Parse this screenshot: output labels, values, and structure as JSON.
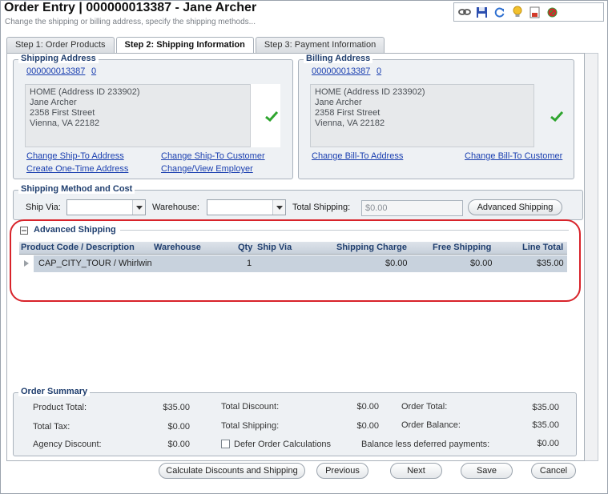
{
  "header": {
    "title": "Order Entry | 000000013387 - Jane Archer",
    "subtitle": "Change the shipping or billing address, specify the shipping methods..."
  },
  "toolbar": {
    "icons": [
      "link-icon",
      "save-icon",
      "refresh-icon",
      "lightbulb-icon",
      "report-icon",
      "cancel-order-icon"
    ]
  },
  "tabs": [
    {
      "label": "Step 1: Order Products",
      "active": false
    },
    {
      "label": "Step 2: Shipping Information",
      "active": true
    },
    {
      "label": "Step 3: Payment Information",
      "active": false
    }
  ],
  "shipping_address": {
    "title": "Shipping Address",
    "id_link": "000000013387",
    "id_suffix_link": "0",
    "lines": [
      "HOME (Address ID 233902)",
      "Jane Archer",
      "2358 First Street",
      "Vienna, VA 22182"
    ],
    "links": {
      "change_ship_to_address": "Change Ship-To Address",
      "create_one_time_address": "Create One-Time Address",
      "change_ship_to_customer": "Change Ship-To Customer",
      "change_view_employer": "Change/View Employer"
    }
  },
  "billing_address": {
    "title": "Billing Address",
    "id_link": "000000013387",
    "id_suffix_link": "0",
    "lines": [
      "HOME (Address ID 233902)",
      "Jane Archer",
      "2358 First Street",
      "Vienna, VA 22182"
    ],
    "links": {
      "change_bill_to_address": "Change Bill-To Address",
      "change_bill_to_customer": "Change Bill-To Customer"
    }
  },
  "shipping_method": {
    "title": "Shipping Method and Cost",
    "ship_via_label": "Ship Via:",
    "ship_via_value": "",
    "warehouse_label": "Warehouse:",
    "warehouse_value": "",
    "total_shipping_label": "Total Shipping:",
    "total_shipping_value": "$0.00",
    "advanced_button": "Advanced Shipping"
  },
  "advanced_shipping": {
    "title": "Advanced Shipping",
    "columns": [
      "Product Code / Description",
      "Warehouse",
      "Qty",
      "Ship Via",
      "Shipping Charge",
      "Free Shipping",
      "Line Total"
    ],
    "rows": [
      {
        "product": "CAP_CITY_TOUR / Whirlwin",
        "warehouse": "",
        "qty": "1",
        "ship_via": "",
        "shipping_charge": "$0.00",
        "free_shipping": "$0.00",
        "line_total": "$35.00"
      }
    ]
  },
  "order_summary": {
    "title": "Order Summary",
    "product_total_label": "Product Total:",
    "product_total": "$35.00",
    "total_tax_label": "Total Tax:",
    "total_tax": "$0.00",
    "agency_discount_label": "Agency Discount:",
    "agency_discount": "$0.00",
    "total_discount_label": "Total Discount:",
    "total_discount": "$0.00",
    "total_shipping_label": "Total Shipping:",
    "total_shipping": "$0.00",
    "defer_label": "Defer Order Calculations",
    "defer_checked": false,
    "order_total_label": "Order Total:",
    "order_total": "$35.00",
    "order_balance_label": "Order Balance:",
    "order_balance": "$35.00",
    "balance_less_label": "Balance less deferred payments:",
    "balance_less": "$0.00"
  },
  "footer": {
    "calculate": "Calculate Discounts and Shipping",
    "previous": "Previous",
    "next": "Next",
    "save": "Save",
    "cancel": "Cancel"
  },
  "colors": {
    "accent": "#1f3e6e",
    "link": "#1a3fb0",
    "highlight": "#d8232a",
    "check": "#2fa52f"
  }
}
